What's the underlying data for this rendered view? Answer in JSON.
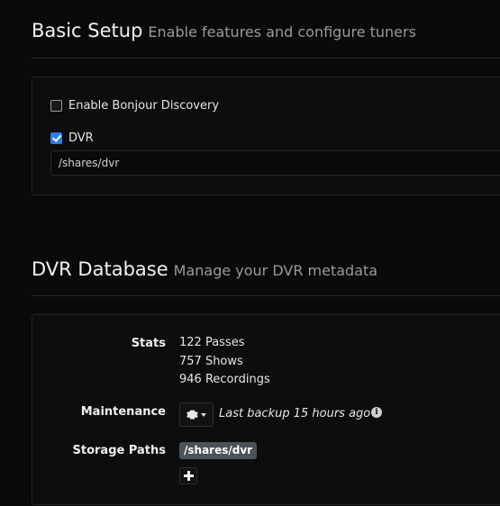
{
  "basic_setup": {
    "title": "Basic Setup",
    "subtitle": "Enable features and configure tuners",
    "bonjour": {
      "label": "Enable Bonjour Discovery",
      "checked": false
    },
    "dvr": {
      "label": "DVR",
      "checked": true
    },
    "dvr_path": {
      "value": "/shares/dvr"
    }
  },
  "dvr_database": {
    "title": "DVR Database",
    "subtitle": "Manage your DVR metadata",
    "stats_label": "Stats",
    "stats": [
      "122 Passes",
      "757 Shows",
      "946 Recordings"
    ],
    "maintenance_label": "Maintenance",
    "maintenance_icon": "gear-icon",
    "last_backup": "Last backup 15 hours ago",
    "storage_label": "Storage Paths",
    "storage_paths": [
      "/shares/dvr"
    ],
    "add_icon": "plus-icon"
  }
}
